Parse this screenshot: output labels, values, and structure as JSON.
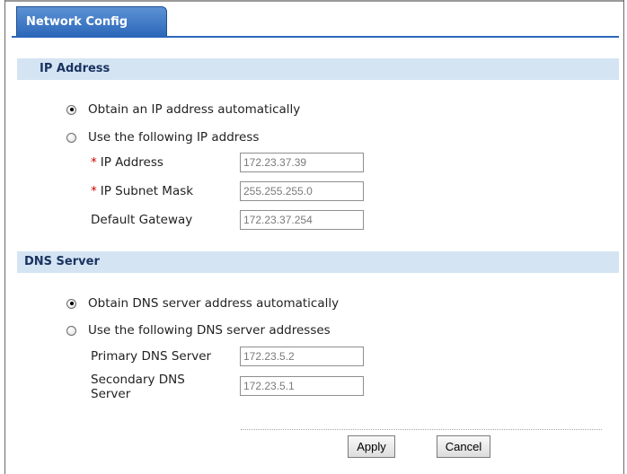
{
  "tab": {
    "label": "Network Config"
  },
  "ip_section": {
    "title": "IP Address",
    "options": [
      {
        "label": "Obtain an IP address automatically",
        "checked": true
      },
      {
        "label": "Use the following IP address",
        "checked": false
      }
    ],
    "fields": [
      {
        "label": "IP Address",
        "required": true,
        "value": "172.23.37.39"
      },
      {
        "label": "IP Subnet Mask",
        "required": true,
        "value": "255.255.255.0"
      },
      {
        "label": "Default Gateway",
        "required": false,
        "value": "172.23.37.254"
      }
    ]
  },
  "dns_section": {
    "title": "DNS Server",
    "options": [
      {
        "label": "Obtain DNS server address automatically",
        "checked": true
      },
      {
        "label": "Use the following DNS server addresses",
        "checked": false
      }
    ],
    "fields": [
      {
        "label": "Primary DNS Server",
        "value": "172.23.5.2"
      },
      {
        "label_line1": "Secondary DNS",
        "label_line2": "Server",
        "value": "172.23.5.1"
      }
    ]
  },
  "required_marker": "*",
  "buttons": {
    "apply": "Apply",
    "cancel": "Cancel"
  }
}
